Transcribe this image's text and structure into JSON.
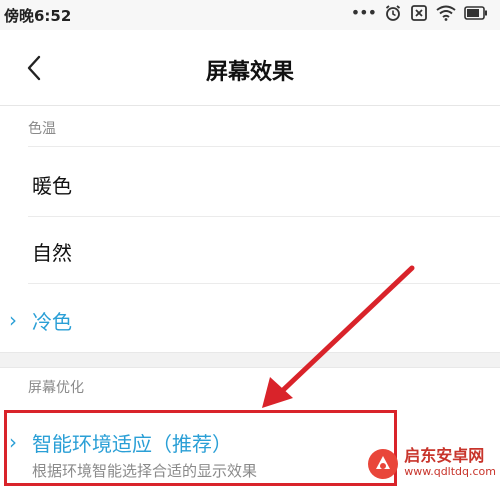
{
  "status_bar": {
    "time": "傍晚6:52",
    "dots": "•••"
  },
  "header": {
    "title": "屏幕效果"
  },
  "color_temp": {
    "label": "色温",
    "options": [
      {
        "label": "暖色",
        "selected": false
      },
      {
        "label": "自然",
        "selected": false
      },
      {
        "label": "冷色",
        "selected": true
      }
    ],
    "check_glyph": "›"
  },
  "optimization": {
    "label": "屏幕优化",
    "item": {
      "title": "智能环境适应（推荐）",
      "description": "根据环境智能选择合适的显示效果",
      "selected": true
    }
  },
  "annotation": {
    "color": "#d9232a"
  },
  "watermark": {
    "name": "启东安卓网",
    "url": "www.qdltdq.com"
  },
  "colors": {
    "accent": "#2a9fd6",
    "text": "#111111",
    "secondary": "#8a8a8a"
  }
}
